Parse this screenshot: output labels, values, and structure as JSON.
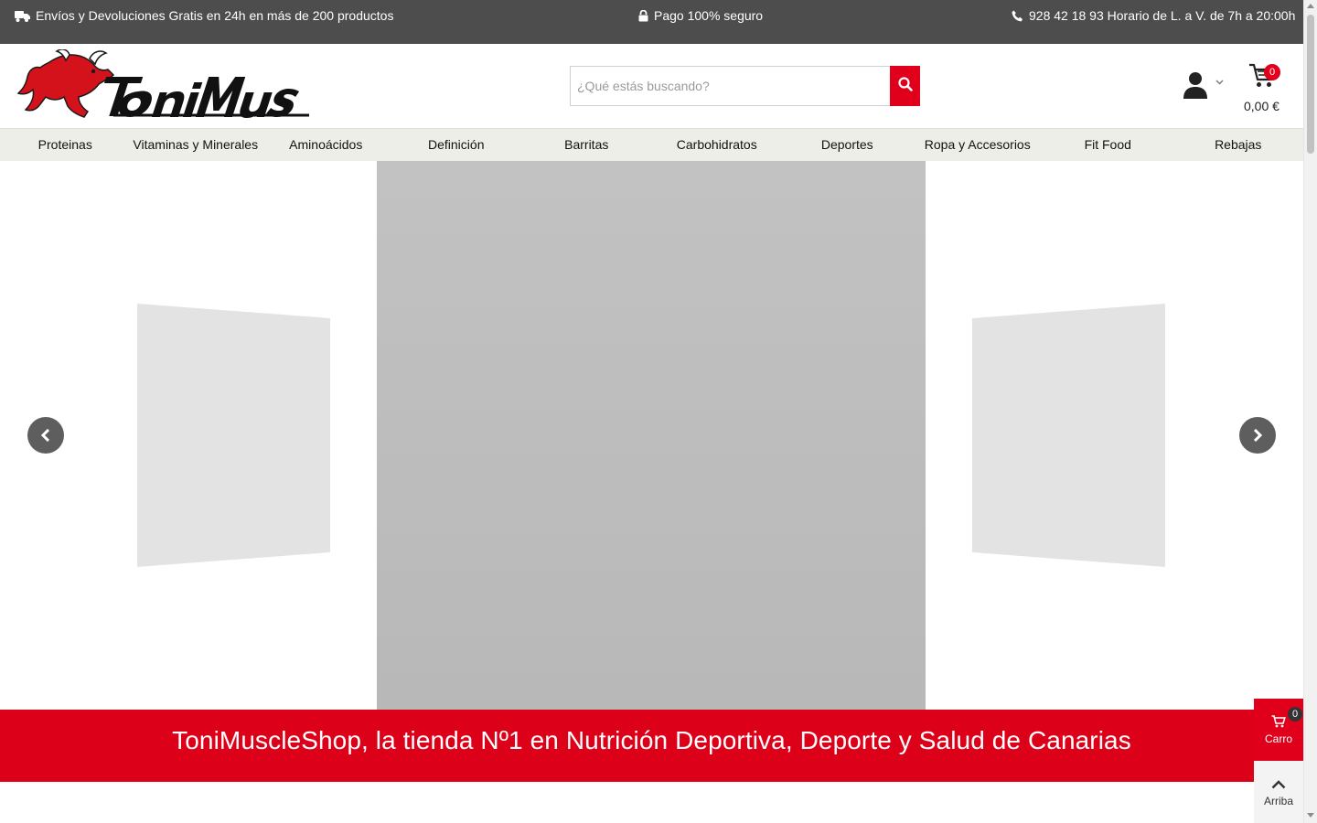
{
  "topbar": {
    "shipping_text": "Envíos y Devoluciones Gratis en 24h en más de 200 productos",
    "payment_text": "Pago 100% seguro",
    "contact_text": "928 42 18 93 Horario de L. a V. de 7h a 20:00h",
    "icons": [
      "truck-icon",
      "lock-icon",
      "phone-icon"
    ]
  },
  "header": {
    "logo_alt": "ToniMuscle",
    "search": {
      "placeholder": "¿Qué estás buscando?",
      "value": ""
    },
    "cart": {
      "count": "0",
      "total": "0,00 €"
    },
    "icons": [
      "search-icon",
      "user-icon",
      "chevron-down-icon",
      "cart-icon"
    ]
  },
  "nav": {
    "items": [
      {
        "label": "Proteinas"
      },
      {
        "label": "Vitaminas y Minerales"
      },
      {
        "label": "Aminoácidos"
      },
      {
        "label": "Definición"
      },
      {
        "label": "Barritas"
      },
      {
        "label": "Carbohidratos"
      },
      {
        "label": "Deportes"
      },
      {
        "label": "Ropa y Accesorios"
      },
      {
        "label": "Fit Food"
      },
      {
        "label": "Rebajas"
      }
    ]
  },
  "carousel": {
    "icons": [
      "chevron-left-icon",
      "chevron-right-icon"
    ]
  },
  "banner": {
    "title": "ToniMuscleShop, la tienda Nº1 en Nutrición Deportiva, Deporte y Salud de Canarias"
  },
  "floating": {
    "cart_count": "0",
    "cart_label": "Carro",
    "top_label": "Arriba"
  },
  "colors": {
    "topbar_bg": "#4d4d4d",
    "accent_red": "#e0001b",
    "nav_bg": "#eeeee8"
  }
}
